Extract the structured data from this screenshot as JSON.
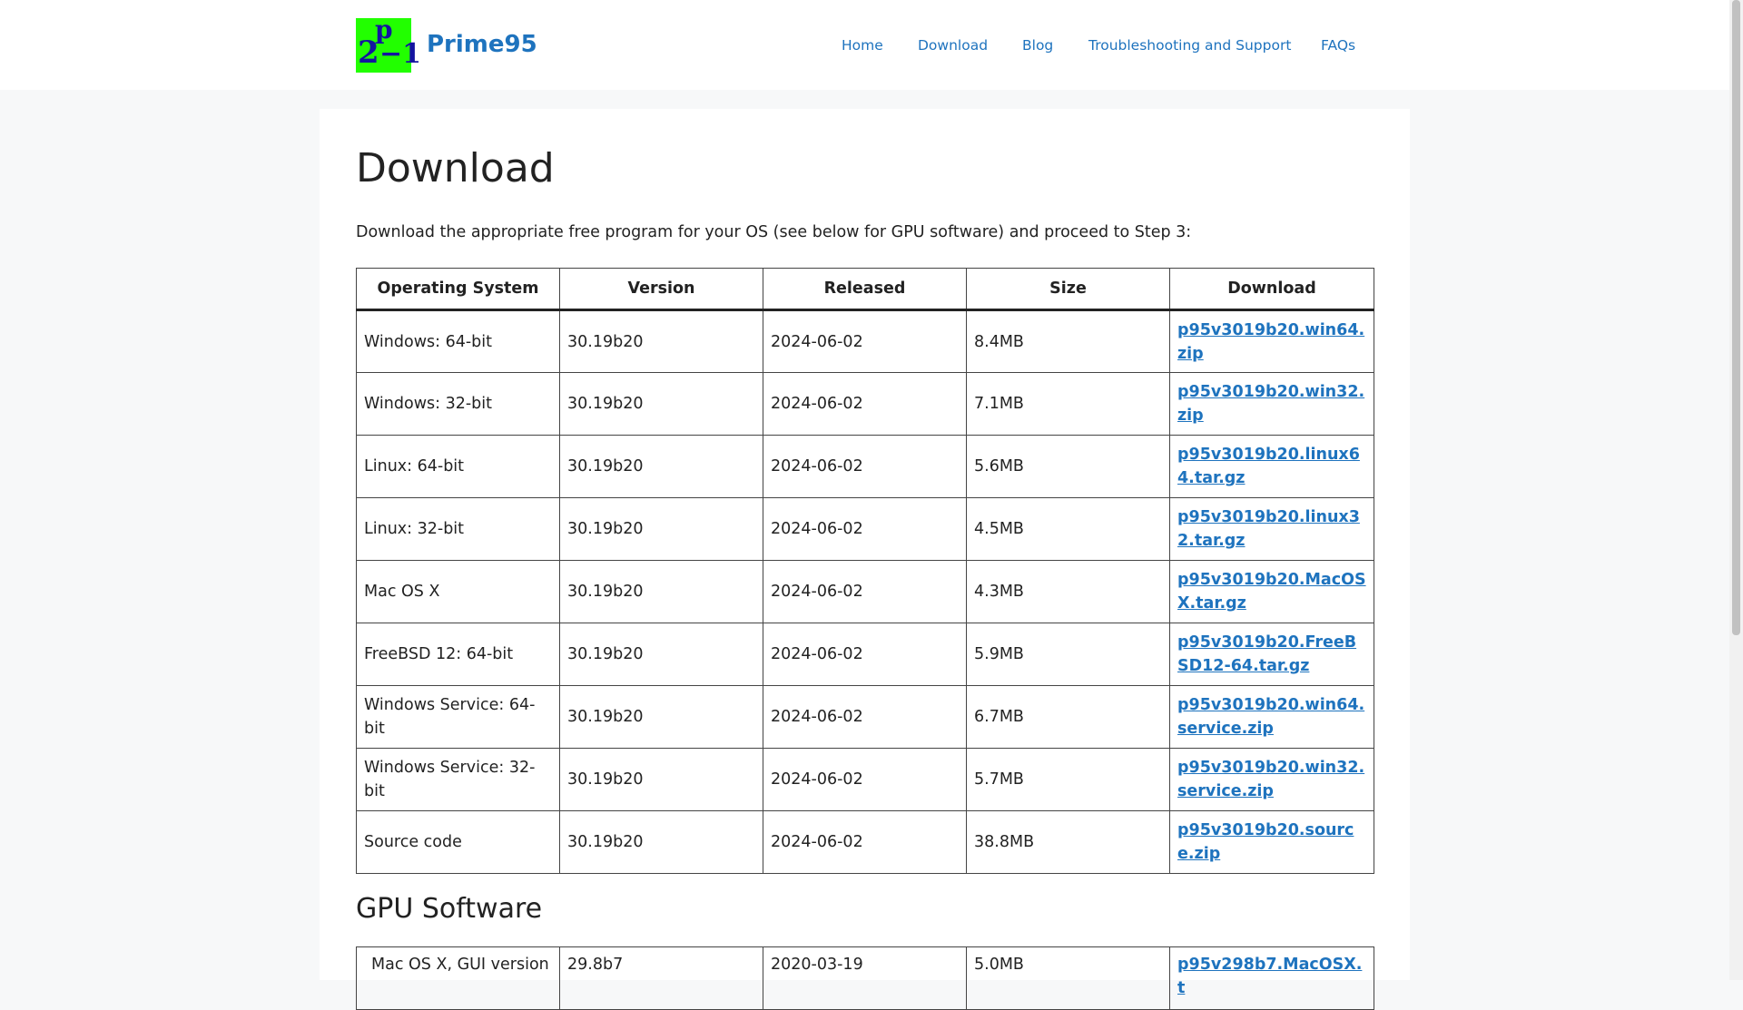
{
  "site": {
    "title": "Prime95",
    "logo_text": {
      "base": "2",
      "exponent": "p",
      "minus_one": "−1"
    }
  },
  "nav": {
    "items": [
      {
        "label": "Home"
      },
      {
        "label": "Download"
      },
      {
        "label": "Blog"
      },
      {
        "label": "Troubleshooting and Support"
      },
      {
        "label": "FAQs"
      }
    ]
  },
  "page": {
    "title": "Download",
    "intro": "Download the appropriate free program for your OS (see below for GPU software) and proceed to Step 3:",
    "gpu_heading": "GPU Software"
  },
  "table": {
    "headers": [
      "Operating System",
      "Version",
      "Released",
      "Size",
      "Download"
    ],
    "rows": [
      {
        "os": "Windows: 64-bit",
        "version": "30.19b20",
        "released": "2024-06-02",
        "size": "8.4MB",
        "file": "p95v3019b20.win64.zip"
      },
      {
        "os": "Windows: 32-bit",
        "version": "30.19b20",
        "released": "2024-06-02",
        "size": "7.1MB",
        "file": "p95v3019b20.win32.zip"
      },
      {
        "os": "Linux: 64-bit",
        "version": "30.19b20",
        "released": "2024-06-02",
        "size": "5.6MB",
        "file": "p95v3019b20.linux64.tar.gz"
      },
      {
        "os": "Linux: 32-bit",
        "version": "30.19b20",
        "released": "2024-06-02",
        "size": "4.5MB",
        "file": "p95v3019b20.linux32.tar.gz"
      },
      {
        "os": "Mac OS X",
        "version": "30.19b20",
        "released": "2024-06-02",
        "size": "4.3MB",
        "file": "p95v3019b20.MacOSX.tar.gz"
      },
      {
        "os": "FreeBSD 12: 64-bit",
        "version": "30.19b20",
        "released": "2024-06-02",
        "size": "5.9MB",
        "file": "p95v3019b20.FreeBSD12-64.tar.gz"
      },
      {
        "os": "Windows Service: 64-bit",
        "version": "30.19b20",
        "released": "2024-06-02",
        "size": "6.7MB",
        "file": "p95v3019b20.win64.service.zip"
      },
      {
        "os": "Windows Service: 32-bit",
        "version": "30.19b20",
        "released": "2024-06-02",
        "size": "5.7MB",
        "file": "p95v3019b20.win32.service.zip"
      },
      {
        "os": "Source code",
        "version": "30.19b20",
        "released": "2024-06-02",
        "size": "38.8MB",
        "file": "p95v3019b20.source.zip"
      }
    ]
  },
  "gpu_table": {
    "rows": [
      {
        "os": "Mac OS X, GUI version",
        "version": "29.8b7",
        "released": "2020-03-19",
        "size": "5.0MB",
        "file": "p95v298b7.MacOSX.t"
      }
    ]
  },
  "colors": {
    "link": "#1e73be",
    "logo_bg": "#22ff00",
    "logo_text": "#1414a0",
    "page_bg": "#f7f8f9"
  }
}
